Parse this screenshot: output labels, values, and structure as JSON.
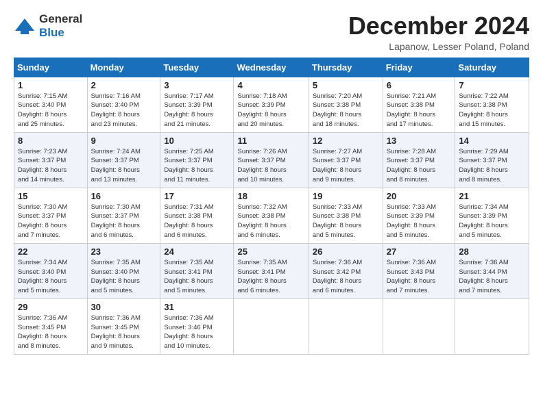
{
  "header": {
    "logo_general": "General",
    "logo_blue": "Blue",
    "month_title": "December 2024",
    "location": "Lapanow, Lesser Poland, Poland"
  },
  "weekdays": [
    "Sunday",
    "Monday",
    "Tuesday",
    "Wednesday",
    "Thursday",
    "Friday",
    "Saturday"
  ],
  "weeks": [
    [
      {
        "day": 1,
        "info": "Sunrise: 7:15 AM\nSunset: 3:40 PM\nDaylight: 8 hours\nand 25 minutes."
      },
      {
        "day": 2,
        "info": "Sunrise: 7:16 AM\nSunset: 3:40 PM\nDaylight: 8 hours\nand 23 minutes."
      },
      {
        "day": 3,
        "info": "Sunrise: 7:17 AM\nSunset: 3:39 PM\nDaylight: 8 hours\nand 21 minutes."
      },
      {
        "day": 4,
        "info": "Sunrise: 7:18 AM\nSunset: 3:39 PM\nDaylight: 8 hours\nand 20 minutes."
      },
      {
        "day": 5,
        "info": "Sunrise: 7:20 AM\nSunset: 3:38 PM\nDaylight: 8 hours\nand 18 minutes."
      },
      {
        "day": 6,
        "info": "Sunrise: 7:21 AM\nSunset: 3:38 PM\nDaylight: 8 hours\nand 17 minutes."
      },
      {
        "day": 7,
        "info": "Sunrise: 7:22 AM\nSunset: 3:38 PM\nDaylight: 8 hours\nand 15 minutes."
      }
    ],
    [
      {
        "day": 8,
        "info": "Sunrise: 7:23 AM\nSunset: 3:37 PM\nDaylight: 8 hours\nand 14 minutes."
      },
      {
        "day": 9,
        "info": "Sunrise: 7:24 AM\nSunset: 3:37 PM\nDaylight: 8 hours\nand 13 minutes."
      },
      {
        "day": 10,
        "info": "Sunrise: 7:25 AM\nSunset: 3:37 PM\nDaylight: 8 hours\nand 11 minutes."
      },
      {
        "day": 11,
        "info": "Sunrise: 7:26 AM\nSunset: 3:37 PM\nDaylight: 8 hours\nand 10 minutes."
      },
      {
        "day": 12,
        "info": "Sunrise: 7:27 AM\nSunset: 3:37 PM\nDaylight: 8 hours\nand 9 minutes."
      },
      {
        "day": 13,
        "info": "Sunrise: 7:28 AM\nSunset: 3:37 PM\nDaylight: 8 hours\nand 8 minutes."
      },
      {
        "day": 14,
        "info": "Sunrise: 7:29 AM\nSunset: 3:37 PM\nDaylight: 8 hours\nand 8 minutes."
      }
    ],
    [
      {
        "day": 15,
        "info": "Sunrise: 7:30 AM\nSunset: 3:37 PM\nDaylight: 8 hours\nand 7 minutes."
      },
      {
        "day": 16,
        "info": "Sunrise: 7:30 AM\nSunset: 3:37 PM\nDaylight: 8 hours\nand 6 minutes."
      },
      {
        "day": 17,
        "info": "Sunrise: 7:31 AM\nSunset: 3:38 PM\nDaylight: 8 hours\nand 6 minutes."
      },
      {
        "day": 18,
        "info": "Sunrise: 7:32 AM\nSunset: 3:38 PM\nDaylight: 8 hours\nand 6 minutes."
      },
      {
        "day": 19,
        "info": "Sunrise: 7:33 AM\nSunset: 3:38 PM\nDaylight: 8 hours\nand 5 minutes."
      },
      {
        "day": 20,
        "info": "Sunrise: 7:33 AM\nSunset: 3:39 PM\nDaylight: 8 hours\nand 5 minutes."
      },
      {
        "day": 21,
        "info": "Sunrise: 7:34 AM\nSunset: 3:39 PM\nDaylight: 8 hours\nand 5 minutes."
      }
    ],
    [
      {
        "day": 22,
        "info": "Sunrise: 7:34 AM\nSunset: 3:40 PM\nDaylight: 8 hours\nand 5 minutes."
      },
      {
        "day": 23,
        "info": "Sunrise: 7:35 AM\nSunset: 3:40 PM\nDaylight: 8 hours\nand 5 minutes."
      },
      {
        "day": 24,
        "info": "Sunrise: 7:35 AM\nSunset: 3:41 PM\nDaylight: 8 hours\nand 5 minutes."
      },
      {
        "day": 25,
        "info": "Sunrise: 7:35 AM\nSunset: 3:41 PM\nDaylight: 8 hours\nand 6 minutes."
      },
      {
        "day": 26,
        "info": "Sunrise: 7:36 AM\nSunset: 3:42 PM\nDaylight: 8 hours\nand 6 minutes."
      },
      {
        "day": 27,
        "info": "Sunrise: 7:36 AM\nSunset: 3:43 PM\nDaylight: 8 hours\nand 7 minutes."
      },
      {
        "day": 28,
        "info": "Sunrise: 7:36 AM\nSunset: 3:44 PM\nDaylight: 8 hours\nand 7 minutes."
      }
    ],
    [
      {
        "day": 29,
        "info": "Sunrise: 7:36 AM\nSunset: 3:45 PM\nDaylight: 8 hours\nand 8 minutes."
      },
      {
        "day": 30,
        "info": "Sunrise: 7:36 AM\nSunset: 3:45 PM\nDaylight: 8 hours\nand 9 minutes."
      },
      {
        "day": 31,
        "info": "Sunrise: 7:36 AM\nSunset: 3:46 PM\nDaylight: 8 hours\nand 10 minutes."
      },
      null,
      null,
      null,
      null
    ]
  ]
}
